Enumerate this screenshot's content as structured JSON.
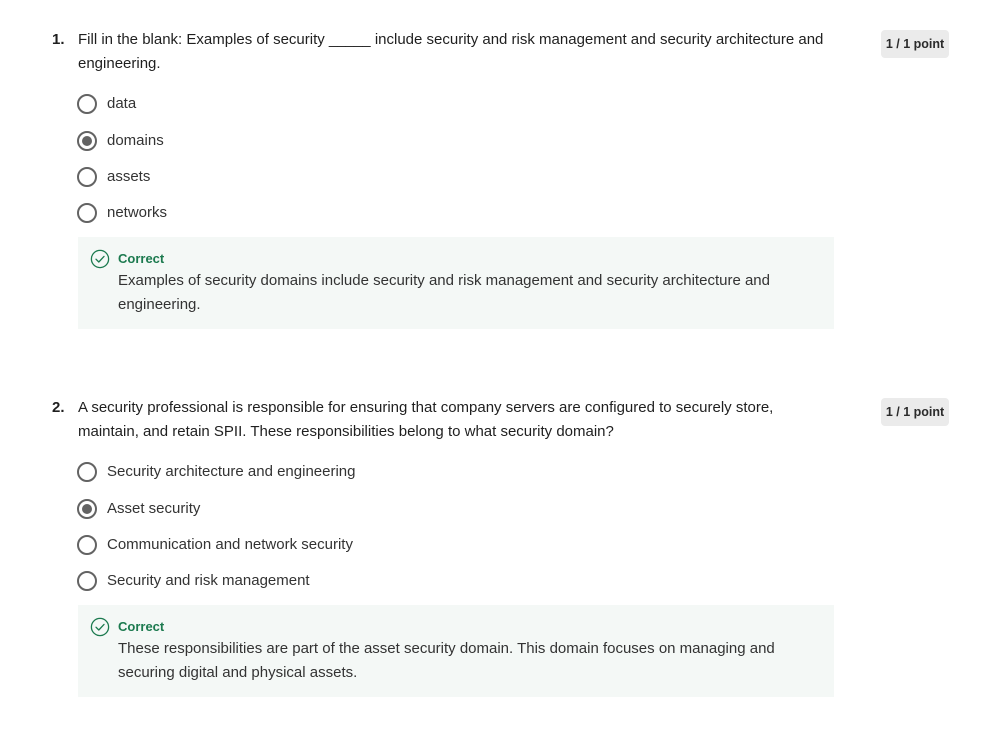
{
  "questions": [
    {
      "number": "1.",
      "text": "Fill in the blank: Examples of security _____ include security and risk management and security architecture and engineering.",
      "score": "1 / 1 point",
      "options": [
        {
          "label": "data",
          "selected": false
        },
        {
          "label": "domains",
          "selected": true
        },
        {
          "label": "assets",
          "selected": false
        },
        {
          "label": "networks",
          "selected": false
        }
      ],
      "feedback": {
        "status": "Correct",
        "text": "Examples of security domains include security and risk management and security architecture and engineering."
      }
    },
    {
      "number": "2.",
      "text": "A security professional is responsible for ensuring that company servers are configured to securely store, maintain, and retain SPII. These responsibilities belong to what security domain?",
      "score": "1 / 1 point",
      "options": [
        {
          "label": "Security architecture and engineering",
          "selected": false
        },
        {
          "label": "Asset security",
          "selected": true
        },
        {
          "label": "Communication and network security",
          "selected": false
        },
        {
          "label": "Security and risk management",
          "selected": false
        }
      ],
      "feedback": {
        "status": "Correct",
        "text": "These responsibilities are part of the asset security domain. This domain focuses on managing and securing digital and physical assets."
      }
    }
  ],
  "colors": {
    "correct_green": "#1c7a4f",
    "feedback_bg": "#f4f8f6",
    "radio_gray": "#636363",
    "badge_bg": "#ebebeb"
  },
  "icons": {
    "feedback_status": "check-circle-icon"
  }
}
